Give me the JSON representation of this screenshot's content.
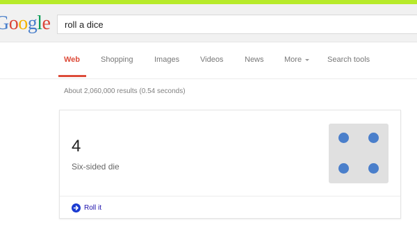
{
  "colors": {
    "top_strip": "#b7ea2a",
    "pip": "#4a7fcb",
    "link": "#1a0dab",
    "roll_icon": "#1a3bd1",
    "active_tab": "#dd4b39"
  },
  "logo": {
    "letters": [
      "G",
      "o",
      "o",
      "g",
      "l",
      "e"
    ],
    "colors": [
      "#4a7fcb",
      "#db4437",
      "#f4b400",
      "#4a7fcb",
      "#0f9d58",
      "#db4437"
    ]
  },
  "search": {
    "value": "roll a dice"
  },
  "tabs": [
    {
      "label": "Web",
      "active": true
    },
    {
      "label": "Shopping",
      "active": false
    },
    {
      "label": "Images",
      "active": false
    },
    {
      "label": "Videos",
      "active": false
    },
    {
      "label": "News",
      "active": false
    },
    {
      "label": "More",
      "active": false,
      "has_caret": true
    },
    {
      "label": "Search tools",
      "active": false
    }
  ],
  "result_stats": "About 2,060,000 results (0.54 seconds)",
  "dice_card": {
    "result": "4",
    "label": "Six-sided die",
    "action_label": "Roll it",
    "face_value": 4
  }
}
